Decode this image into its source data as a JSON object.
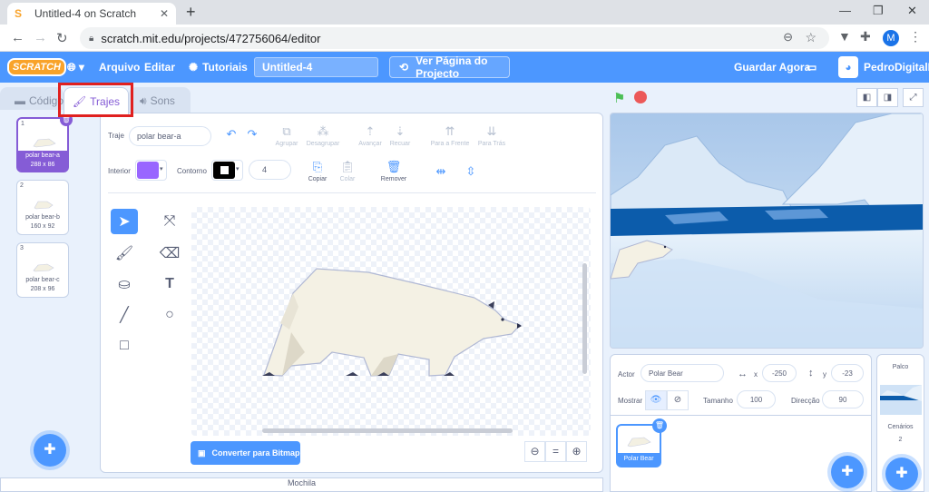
{
  "browser": {
    "tab_title": "Untitled-4 on Scratch",
    "url": "scratch.mit.edu/projects/472756064/editor",
    "profile_initial": "M"
  },
  "menu": {
    "logo": "SCRATCH",
    "file": "Arquivo",
    "edit": "Editar",
    "tutorials": "Tutoriais",
    "project_title": "Untitled-4",
    "share": "Ver Página do Projecto",
    "save_now": "Guardar Agora",
    "username": "PedroDigitalI"
  },
  "editor_tabs": {
    "code": "Código",
    "costumes": "Trajes",
    "sounds": "Sons"
  },
  "costumes": [
    {
      "num": "1",
      "name": "polar bear-a",
      "size": "288 x 86"
    },
    {
      "num": "2",
      "name": "polar bear-b",
      "size": "160 x 92"
    },
    {
      "num": "3",
      "name": "polar bear-c",
      "size": "208 x 96"
    }
  ],
  "paint": {
    "costume_label": "Traje",
    "costume_name": "polar bear-a",
    "group": "Agrupar",
    "ungroup": "Desagrupar",
    "forward": "Avançar",
    "backward": "Recuar",
    "front": "Para a Frente",
    "back": "Para Trás",
    "fill_label": "Interior",
    "outline_label": "Contorno",
    "outline_width": "4",
    "copy": "Copiar",
    "paste": "Colar",
    "delete": "Remover",
    "bitmap_button": "Converter para Bitmap",
    "fill_color": "#9966ff",
    "outline_color": "#000000"
  },
  "backpack": "Mochila",
  "sprite_info": {
    "sprite_label": "Actor",
    "sprite_name": "Polar Bear",
    "x_label": "x",
    "x_value": "-250",
    "y_label": "y",
    "y_value": "-23",
    "show_label": "Mostrar",
    "size_label": "Tamanho",
    "size_value": "100",
    "direction_label": "Direcção",
    "direction_value": "90"
  },
  "sprite_tile": "Polar Bear",
  "stage_panel": {
    "title": "Palco",
    "backdrops_label": "Cenários",
    "backdrops_count": "2"
  }
}
